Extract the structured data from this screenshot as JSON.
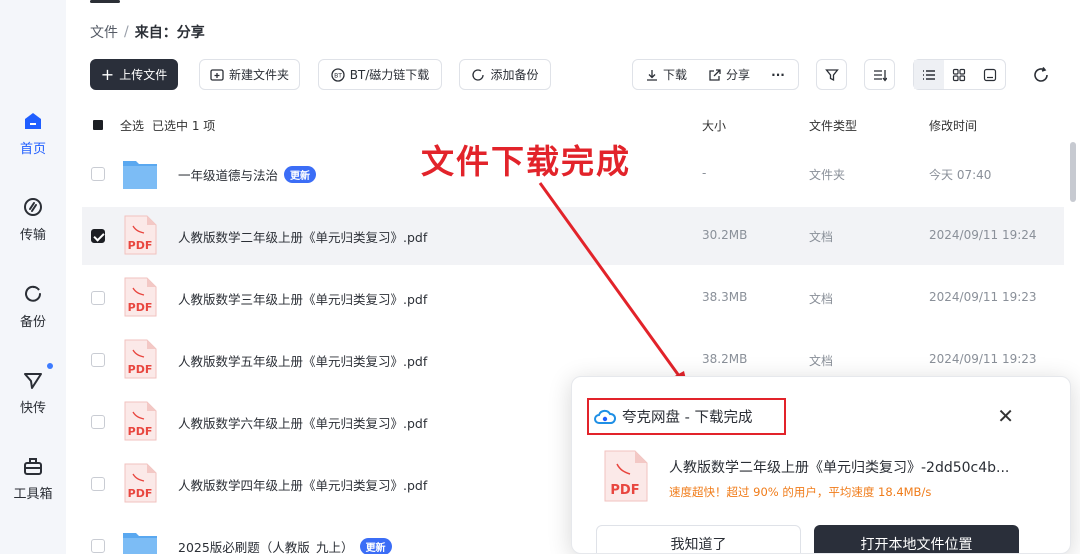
{
  "sidebar": {
    "items": [
      {
        "label": "首页",
        "icon": "home-icon"
      },
      {
        "label": "传输",
        "icon": "transfer-icon"
      },
      {
        "label": "备份",
        "icon": "backup-icon"
      },
      {
        "label": "快传",
        "icon": "quick-send-icon"
      },
      {
        "label": "工具箱",
        "icon": "toolbox-icon"
      }
    ]
  },
  "breadcrumb": {
    "root": "文件",
    "sep": "/",
    "current": "来自：分享"
  },
  "toolbar": {
    "upload": "上传文件",
    "new_folder": "新建文件夹",
    "bt_download": "BT/磁力链下载",
    "add_backup": "添加备份",
    "download": "下载",
    "share": "分享",
    "more": "···"
  },
  "table": {
    "select_all": "全选",
    "selected_info": "已选中  1  项",
    "columns": {
      "size": "大小",
      "type": "文件类型",
      "modified": "修改时间"
    },
    "rows": [
      {
        "name": "一年级道德与法治",
        "badge": "更新",
        "size": "-",
        "type": "文件夹",
        "time": "今天 07:40",
        "kind": "folder",
        "checked": false
      },
      {
        "name": "人教版数学二年级上册《单元归类复习》.pdf",
        "badge": "",
        "size": "30.2MB",
        "type": "文档",
        "time": "2024/09/11 19:24",
        "kind": "pdf",
        "checked": true
      },
      {
        "name": "人教版数学三年级上册《单元归类复习》.pdf",
        "badge": "",
        "size": "38.3MB",
        "type": "文档",
        "time": "2024/09/11 19:23",
        "kind": "pdf",
        "checked": false
      },
      {
        "name": "人教版数学五年级上册《单元归类复习》.pdf",
        "badge": "",
        "size": "38.2MB",
        "type": "文档",
        "time": "2024/09/11 19:23",
        "kind": "pdf",
        "checked": false
      },
      {
        "name": "人教版数学六年级上册《单元归类复习》.pdf",
        "badge": "",
        "size": "",
        "type": "",
        "time": "",
        "kind": "pdf",
        "checked": false
      },
      {
        "name": "人教版数学四年级上册《单元归类复习》.pdf",
        "badge": "",
        "size": "",
        "type": "",
        "time": "",
        "kind": "pdf",
        "checked": false
      },
      {
        "name": "2025版必刷题（人教版_九上）",
        "badge": "更新",
        "size": "",
        "type": "",
        "time": "",
        "kind": "folder",
        "checked": false
      }
    ]
  },
  "annotation": {
    "text": "文件下载完成",
    "color": "#e2232a"
  },
  "popup": {
    "title": "夸克网盘 - 下载完成",
    "file_name": "人教版数学二年级上册《单元归类复习》-2dd50c4b...",
    "speed_text": "速度超快！超过 90% 的用户，平均速度 18.4MB/s",
    "dismiss": "我知道了",
    "open_location": "打开本地文件位置",
    "close": "✕"
  },
  "colors": {
    "accent": "#1f5eff",
    "dark_button": "#2a2f3a",
    "highlight_red": "#e2232a",
    "pdf_red": "#e8463f",
    "folder_blue": "#5aa8f0",
    "speed_orange": "#f07c1a"
  }
}
